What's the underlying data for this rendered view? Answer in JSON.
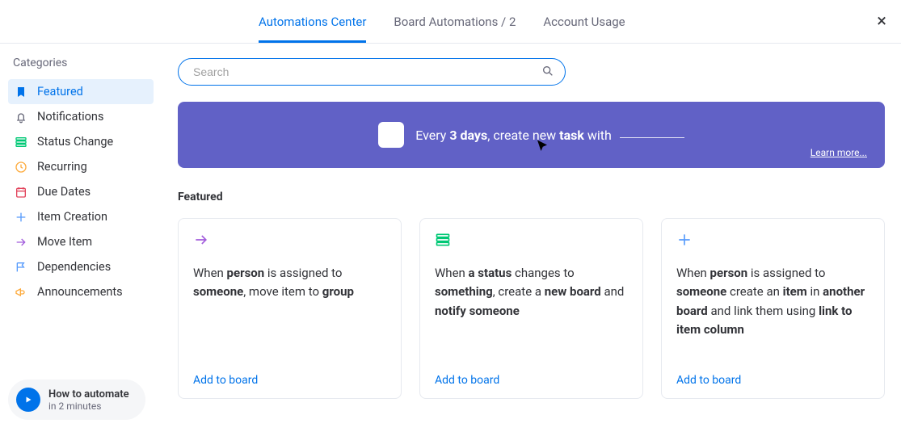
{
  "header": {
    "tabs": [
      {
        "label": "Automations Center",
        "active": true
      },
      {
        "label": "Board Automations / 2",
        "active": false
      },
      {
        "label": "Account Usage",
        "active": false
      }
    ],
    "close_label": "×"
  },
  "sidebar": {
    "title": "Categories",
    "items": [
      {
        "label": "Featured",
        "icon": "bookmark-icon",
        "color": "#0073ea",
        "active": true
      },
      {
        "label": "Notifications",
        "icon": "bell-icon",
        "color": "#676879",
        "active": false
      },
      {
        "label": "Status Change",
        "icon": "status-icon",
        "color": "#00c875",
        "active": false
      },
      {
        "label": "Recurring",
        "icon": "clock-icon",
        "color": "#fdab3d",
        "active": false
      },
      {
        "label": "Due Dates",
        "icon": "calendar-icon",
        "color": "#e2445c",
        "active": false
      },
      {
        "label": "Item Creation",
        "icon": "plus-icon",
        "color": "#579bfc",
        "active": false
      },
      {
        "label": "Move Item",
        "icon": "arrow-icon",
        "color": "#a25ddc",
        "active": false
      },
      {
        "label": "Dependencies",
        "icon": "flag-icon",
        "color": "#579bfc",
        "active": false
      },
      {
        "label": "Announcements",
        "icon": "megaphone-icon",
        "color": "#fdab3d",
        "active": false
      }
    ]
  },
  "tutorial": {
    "title": "How to automate",
    "subtitle": "in 2 minutes"
  },
  "search": {
    "placeholder": "Search"
  },
  "banner": {
    "prefix": "Every ",
    "bold1": "3 days",
    "middle": ", create new ",
    "bold2": "task",
    "suffix": " with ",
    "learn_more": "Learn more..."
  },
  "section_title": "Featured",
  "cards": [
    {
      "icon": "arrow-icon",
      "icon_color": "#a25ddc",
      "segments": [
        {
          "t": "When ",
          "b": false
        },
        {
          "t": "person",
          "b": true
        },
        {
          "t": " is assigned to ",
          "b": false
        },
        {
          "t": "someone",
          "b": true
        },
        {
          "t": ", move item to ",
          "b": false
        },
        {
          "t": "group",
          "b": true
        }
      ],
      "action": "Add to board"
    },
    {
      "icon": "status-icon",
      "icon_color": "#00c875",
      "segments": [
        {
          "t": "When ",
          "b": false
        },
        {
          "t": "a status",
          "b": true
        },
        {
          "t": " changes to ",
          "b": false
        },
        {
          "t": "something",
          "b": true
        },
        {
          "t": ", create a ",
          "b": false
        },
        {
          "t": "new board",
          "b": true
        },
        {
          "t": " and ",
          "b": false
        },
        {
          "t": "notify someone",
          "b": true
        }
      ],
      "action": "Add to board"
    },
    {
      "icon": "plus-icon",
      "icon_color": "#579bfc",
      "segments": [
        {
          "t": "When ",
          "b": false
        },
        {
          "t": "person",
          "b": true
        },
        {
          "t": " is assigned to ",
          "b": false
        },
        {
          "t": "someone",
          "b": true
        },
        {
          "t": " create an ",
          "b": false
        },
        {
          "t": "item",
          "b": true
        },
        {
          "t": " in ",
          "b": false
        },
        {
          "t": "another board",
          "b": true
        },
        {
          "t": " and link them using ",
          "b": false
        },
        {
          "t": "link to item column",
          "b": true
        }
      ],
      "action": "Add to board"
    }
  ]
}
